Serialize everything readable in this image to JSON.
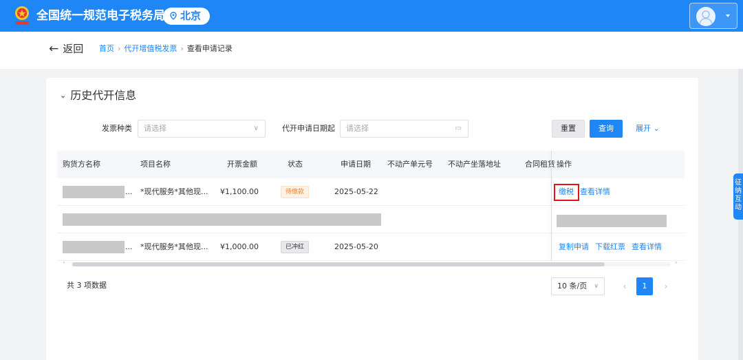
{
  "header": {
    "title": "全国统一规范电子税务局",
    "region": "北京",
    "colors": {
      "primary": "#1e86f5",
      "white": "#ffffff"
    }
  },
  "breadcrumb": {
    "back_label": "返回",
    "items": [
      "首页",
      "代开增值税发票",
      "查看申请记录"
    ]
  },
  "section": {
    "title": "历史代开信息"
  },
  "filters": {
    "invoice_type_label": "发票种类",
    "invoice_type_placeholder": "请选择",
    "date_label": "代开申请日期起",
    "date_placeholder": "请选择",
    "reset_label": "重置",
    "query_label": "查询",
    "expand_label": "展开"
  },
  "table": {
    "columns": [
      "购货方名称",
      "项目名称",
      "开票金额",
      "状态",
      "申请日期",
      "不动产单元号",
      "不动产坐落地址",
      "合同租赁",
      "操作"
    ],
    "rows": [
      {
        "buyer_suffix": "...",
        "item": "*现代服务*其他现...",
        "amount": "¥1,100.00",
        "status": "待缴款",
        "date": "2025-05-22",
        "actions": [
          "缴税",
          "查看详情"
        ]
      },
      {
        "buyer_suffix": "...",
        "item": "*现代服务*其他现...",
        "amount": "¥1,000.00",
        "status": "已冲红",
        "date": "2025-05-20",
        "actions": [
          "复制申请",
          "下载红票",
          "查看详情"
        ]
      }
    ]
  },
  "pagination": {
    "total_text": "共 3 项数据",
    "page_size": "10 条/页",
    "current_page": "1",
    "prev_icon": "‹",
    "next_icon": "›"
  },
  "side_tab": {
    "chars": [
      "征",
      "纳",
      "互",
      "动"
    ]
  }
}
